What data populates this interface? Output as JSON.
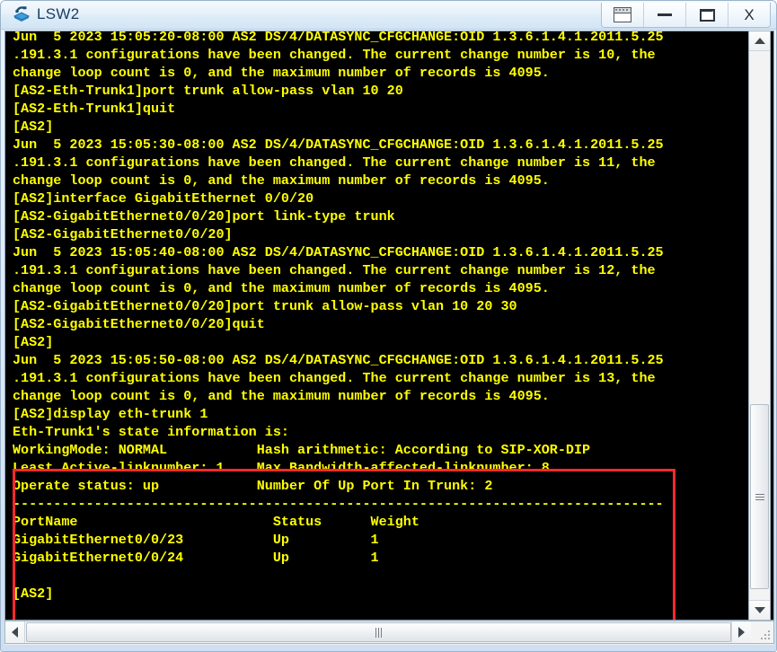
{
  "window": {
    "title": "LSW2",
    "app_icon": "switch-icon",
    "buttons": [
      {
        "name": "restore-window-button",
        "icon": "window-icon",
        "label": ""
      },
      {
        "name": "minimize-button",
        "icon": "minimize-icon",
        "label": ""
      },
      {
        "name": "maximize-button",
        "icon": "maximize-icon",
        "label": ""
      },
      {
        "name": "close-button",
        "icon": "close-icon",
        "label": "X"
      }
    ]
  },
  "terminal": {
    "foreground_color": "#ffff00",
    "background_color": "#000000",
    "highlight_color": "#ff2a2a",
    "lines": [
      "Jun  5 2023 15:05:20-08:00 AS2 DS/4/DATASYNC_CFGCHANGE:OID 1.3.6.1.4.1.2011.5.25",
      ".191.3.1 configurations have been changed. The current change number is 10, the",
      "change loop count is 0, and the maximum number of records is 4095.",
      "[AS2-Eth-Trunk1]port trunk allow-pass vlan 10 20",
      "[AS2-Eth-Trunk1]quit",
      "[AS2]",
      "Jun  5 2023 15:05:30-08:00 AS2 DS/4/DATASYNC_CFGCHANGE:OID 1.3.6.1.4.1.2011.5.25",
      ".191.3.1 configurations have been changed. The current change number is 11, the",
      "change loop count is 0, and the maximum number of records is 4095.",
      "[AS2]interface GigabitEthernet 0/0/20",
      "[AS2-GigabitEthernet0/0/20]port link-type trunk",
      "[AS2-GigabitEthernet0/0/20]",
      "Jun  5 2023 15:05:40-08:00 AS2 DS/4/DATASYNC_CFGCHANGE:OID 1.3.6.1.4.1.2011.5.25",
      ".191.3.1 configurations have been changed. The current change number is 12, the",
      "change loop count is 0, and the maximum number of records is 4095.",
      "[AS2-GigabitEthernet0/0/20]port trunk allow-pass vlan 10 20 30",
      "[AS2-GigabitEthernet0/0/20]quit",
      "[AS2]",
      "Jun  5 2023 15:05:50-08:00 AS2 DS/4/DATASYNC_CFGCHANGE:OID 1.3.6.1.4.1.2011.5.25",
      ".191.3.1 configurations have been changed. The current change number is 13, the",
      "change loop count is 0, and the maximum number of records is 4095.",
      "[AS2]display eth-trunk 1",
      "Eth-Trunk1's state information is:",
      "WorkingMode: NORMAL           Hash arithmetic: According to SIP-XOR-DIP",
      "Least Active-linknumber: 1    Max Bandwidth-affected-linknumber: 8",
      "Operate status: up            Number Of Up Port In Trunk: 2",
      "--------------------------------------------------------------------------------",
      "PortName                        Status      Weight",
      "GigabitEthernet0/0/23           Up          1",
      "GigabitEthernet0/0/24           Up          1",
      "",
      "[AS2]"
    ]
  },
  "scrollbars": {
    "vertical": {
      "up_label": "scroll-up",
      "down_label": "scroll-down"
    },
    "horizontal": {
      "left_label": "scroll-left",
      "right_label": "scroll-right"
    }
  }
}
